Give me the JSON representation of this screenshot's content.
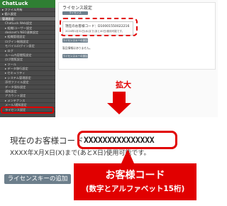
{
  "sidebar": {
    "logo": "ChatLuck",
    "items": [
      {
        "label": "▸ ファイル共有",
        "type": "item"
      },
      {
        "label": "▸ 個人設定",
        "type": "item"
      },
      {
        "label": "管理設定",
        "type": "hl"
      },
      {
        "label": "ChatLuck Web設定",
        "type": "sub"
      },
      {
        "label": "▸ 組織/ユーザー設定",
        "type": "sub"
      },
      {
        "label": "desknet's NEO連携設定",
        "type": "sub"
      },
      {
        "label": "▸ 組織管理設定",
        "type": "sub"
      },
      {
        "label": "ログイン制限設定",
        "type": "sub"
      },
      {
        "label": "モバイルログイン設定",
        "type": "sub"
      },
      {
        "label": "▸ ログ",
        "type": "sub"
      },
      {
        "label": "ルーム内容閲覧設定",
        "type": "sub"
      },
      {
        "label": "ログ閲覧設定",
        "type": "sub"
      },
      {
        "label": "▸ ツール",
        "type": "sub"
      },
      {
        "label": "▸ データ移行設定",
        "type": "sub"
      },
      {
        "label": "▸ セキュリティ",
        "type": "sub"
      },
      {
        "label": "▸ システム管理設定",
        "type": "sub"
      },
      {
        "label": "添付ファイル設定",
        "type": "sub"
      },
      {
        "label": "データ保存設定",
        "type": "sub"
      },
      {
        "label": "通知設定",
        "type": "sub"
      },
      {
        "label": "アカウント設定",
        "type": "sub"
      },
      {
        "label": "▸ メンテナンス",
        "type": "sub"
      },
      {
        "label": "メール/通知設定",
        "type": "sub"
      },
      {
        "label": "ライセンス設定",
        "type": "sub"
      }
    ]
  },
  "panel": {
    "title": "ライセンス設定",
    "tab": "ライセンス",
    "code_line": "現在のお客様コード：D10001550022216",
    "expiry_line": "2024年1月31日(水)まで(あと40日)使用可能です。",
    "button1": "ライセンスキーの追加",
    "message": "製品情報はありません。",
    "button2": "ライセンスキーの追加"
  },
  "zoom_label": "拡大",
  "enlarged": {
    "code_label": "現在のお客様コード",
    "code_value": "XXXXXXXXXXXXXXX",
    "expiry": "XXXX年X月X日(X)まで(あとX日)使用可能です。",
    "add_key_button": "ライセンスキーの追加"
  },
  "callout": {
    "line1": "お客様コード",
    "line2": "(数字とアルファベット15桁)"
  },
  "colors": {
    "accent_red": "#e10000",
    "sidebar_bg": "#4a4a4a",
    "button_bg": "#6d7f8c",
    "logo_green": "#2f7f33"
  }
}
